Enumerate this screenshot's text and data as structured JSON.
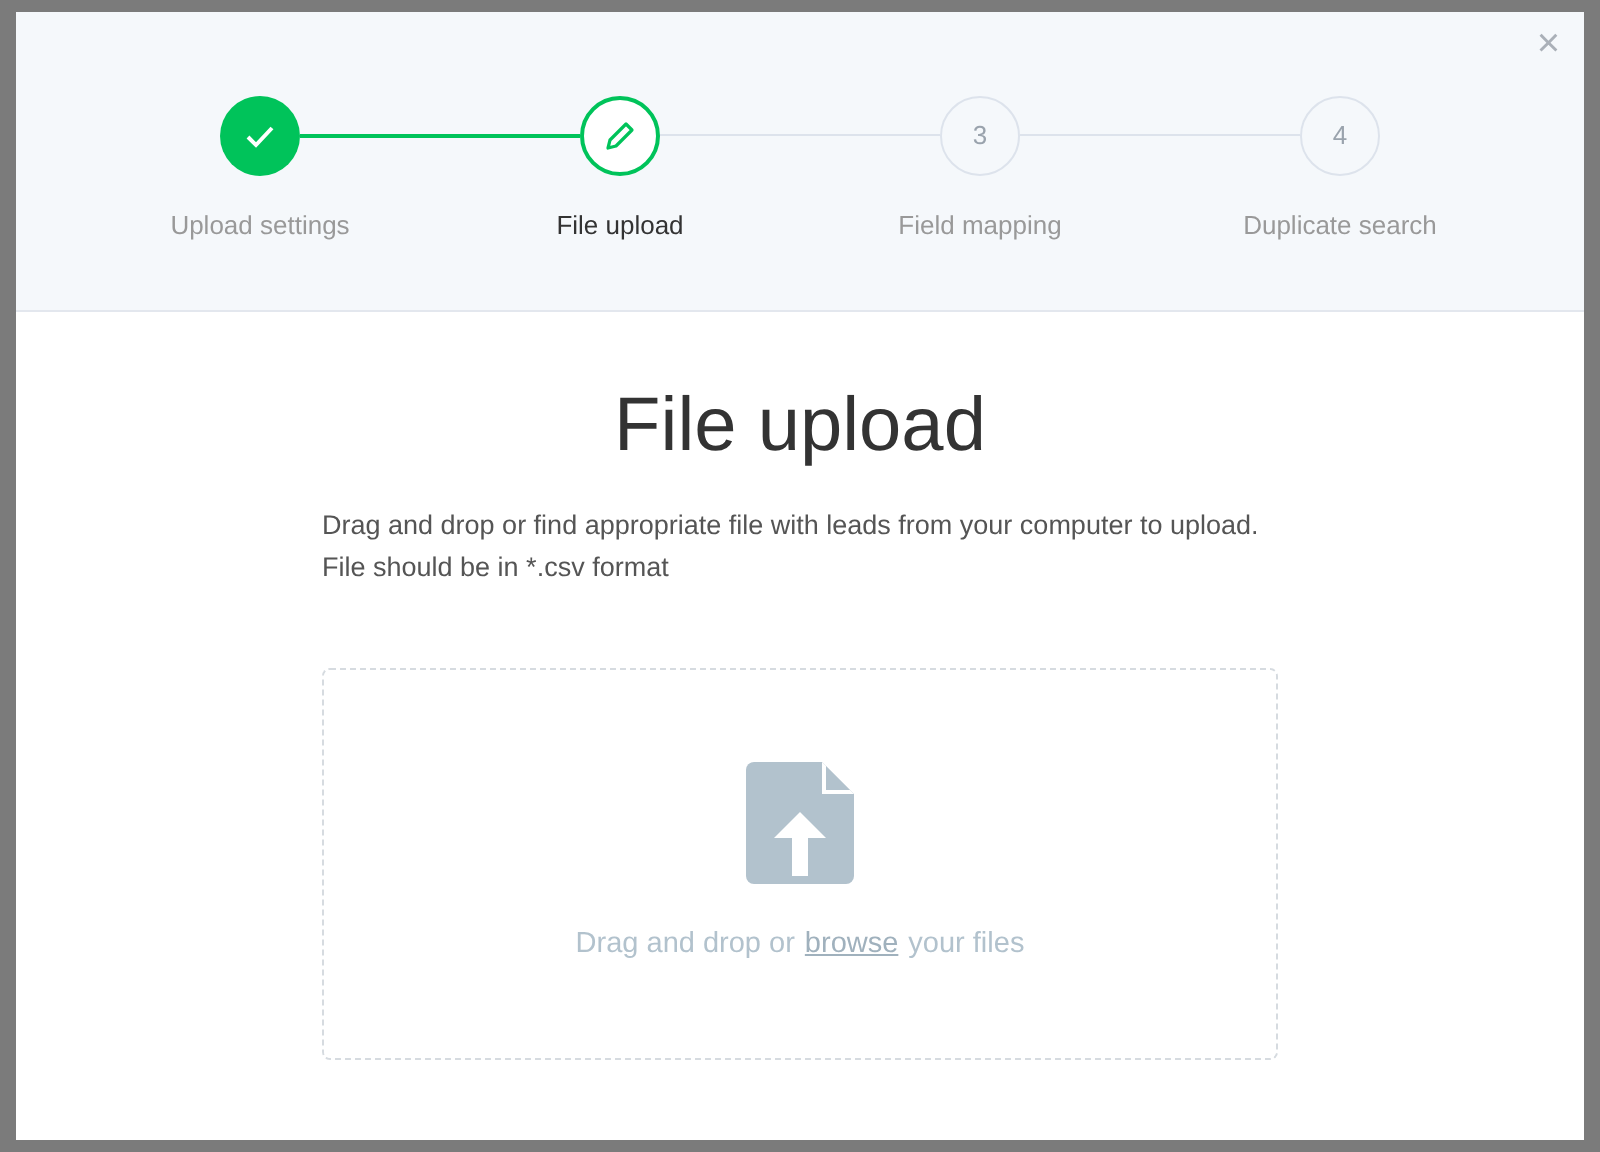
{
  "modal": {
    "close": "×",
    "steps": [
      {
        "label": "Upload settings",
        "kind": "done",
        "selected": false
      },
      {
        "label": "File upload",
        "kind": "current",
        "selected": true
      },
      {
        "label": "Field mapping",
        "number": "3",
        "kind": "pending",
        "selected": false
      },
      {
        "label": "Duplicate search",
        "number": "4",
        "kind": "pending",
        "selected": false
      }
    ],
    "title": "File upload",
    "description": "Drag and drop or find appropriate file with leads from your computer to upload. File should be in *.csv format",
    "dropzone": {
      "text_before": "Drag and drop or",
      "link": "browse",
      "text_after": "your files"
    }
  }
}
